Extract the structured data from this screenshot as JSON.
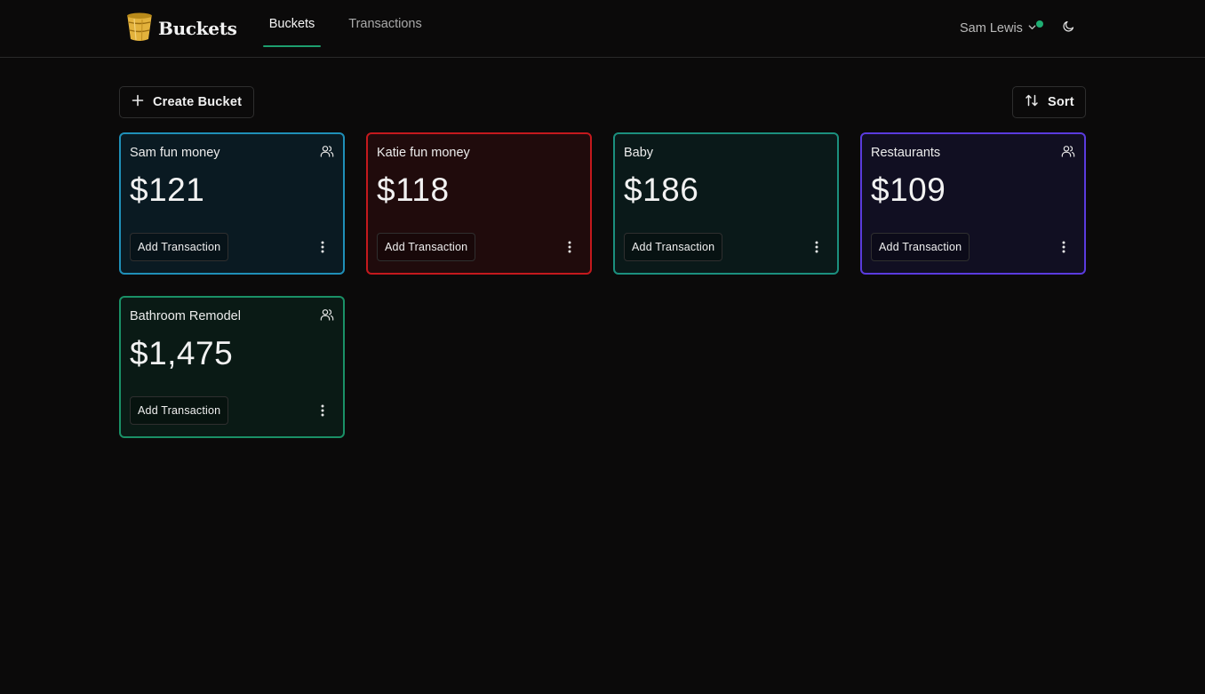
{
  "app": {
    "name": "Buckets",
    "logo_icon": "bucket-icon"
  },
  "nav": {
    "tabs": [
      {
        "label": "Buckets",
        "active": true
      },
      {
        "label": "Transactions",
        "active": false
      }
    ]
  },
  "user": {
    "name": "Sam Lewis",
    "status_color": "#1fae73"
  },
  "toolbar": {
    "create_label": "Create Bucket",
    "sort_label": "Sort"
  },
  "buckets": [
    {
      "name": "Sam fun money",
      "amount": "$121",
      "shared": true,
      "border": "#1f8fb8",
      "bg": "#0a1a22",
      "add_label": "Add Transaction"
    },
    {
      "name": "Katie fun money",
      "amount": "$118",
      "shared": false,
      "border": "#c4191d",
      "bg": "#200b0c",
      "add_label": "Add Transaction"
    },
    {
      "name": "Baby",
      "amount": "$186",
      "shared": false,
      "border": "#1b8f7e",
      "bg": "#0a1919",
      "add_label": "Add Transaction"
    },
    {
      "name": "Restaurants",
      "amount": "$109",
      "shared": true,
      "border": "#5a3bde",
      "bg": "#110f22",
      "add_label": "Add Transaction"
    },
    {
      "name": "Bathroom Remodel",
      "amount": "$1,475",
      "shared": true,
      "border": "#1a9066",
      "bg": "#0a1a15",
      "add_label": "Add Transaction"
    }
  ]
}
